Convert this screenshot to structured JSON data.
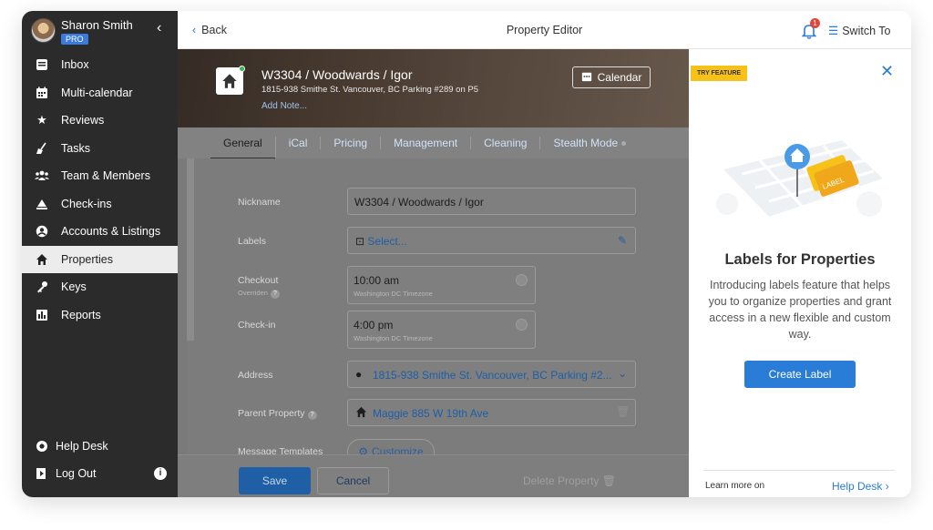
{
  "user": {
    "name": "Sharon Smith",
    "badge": "PRO"
  },
  "sidebar": {
    "collapse_icon": "chevron-left-icon",
    "items": [
      {
        "label": "Inbox",
        "icon": "inbox-icon"
      },
      {
        "label": "Multi-calendar",
        "icon": "calendar-icon"
      },
      {
        "label": "Reviews",
        "icon": "star-icon"
      },
      {
        "label": "Tasks",
        "icon": "broom-icon"
      },
      {
        "label": "Team & Members",
        "icon": "team-icon"
      },
      {
        "label": "Check-ins",
        "icon": "check-in-icon"
      },
      {
        "label": "Accounts & Listings",
        "icon": "account-icon"
      },
      {
        "label": "Properties",
        "icon": "home-icon",
        "active": true
      },
      {
        "label": "Keys",
        "icon": "key-icon"
      },
      {
        "label": "Reports",
        "icon": "reports-icon"
      }
    ],
    "help_desk": "Help Desk",
    "log_out": "Log Out"
  },
  "topbar": {
    "back": "Back",
    "title": "Property Editor",
    "notification_count": "1",
    "switch_to": "Switch To"
  },
  "property": {
    "title": "W3304 / Woodwards / Igor",
    "address": "1815-938 Smithe St. Vancouver, BC Parking #289 on P5",
    "add_note": "Add Note...",
    "calendar_button": "Calendar"
  },
  "tabs": [
    "General",
    "iCal",
    "Pricing",
    "Management",
    "Cleaning",
    "Stealth Mode"
  ],
  "form": {
    "nickname_label": "Nickname",
    "nickname_value": "W3304 / Woodwards / Igor",
    "labels_label": "Labels",
    "labels_placeholder": "Select...",
    "checkout_label": "Checkout",
    "checkout_sub": "Overriden",
    "checkout_time": "10:00 am",
    "checkout_tz": "Washington DC Timezone",
    "checkin_label": "Check-in",
    "checkin_time": "4:00 pm",
    "checkin_tz": "Washington DC Timezone",
    "address_label": "Address",
    "address_value": "1815-938 Smithe St. Vancouver, BC Parking #2...",
    "parent_label": "Parent Property",
    "parent_value": "Maggie 885 W 19th Ave",
    "templates_label": "Message Templates",
    "customize": "Customize"
  },
  "footer": {
    "save": "Save",
    "cancel": "Cancel",
    "delete": "Delete Property"
  },
  "panel": {
    "tag": "TRY FEATURE",
    "illustration_label": "LABEL",
    "title": "Labels for Properties",
    "description": "Introducing labels feature that helps you to organize properties and grant access in a new flexible and custom way.",
    "cta": "Create Label",
    "learn_more": "Learn more on",
    "help_desk": "Help Desk"
  },
  "colors": {
    "accent": "#2a7dd6",
    "sidebar": "#2b2b2b",
    "feature_tag": "#f6c21a",
    "notification": "#e0463a"
  }
}
